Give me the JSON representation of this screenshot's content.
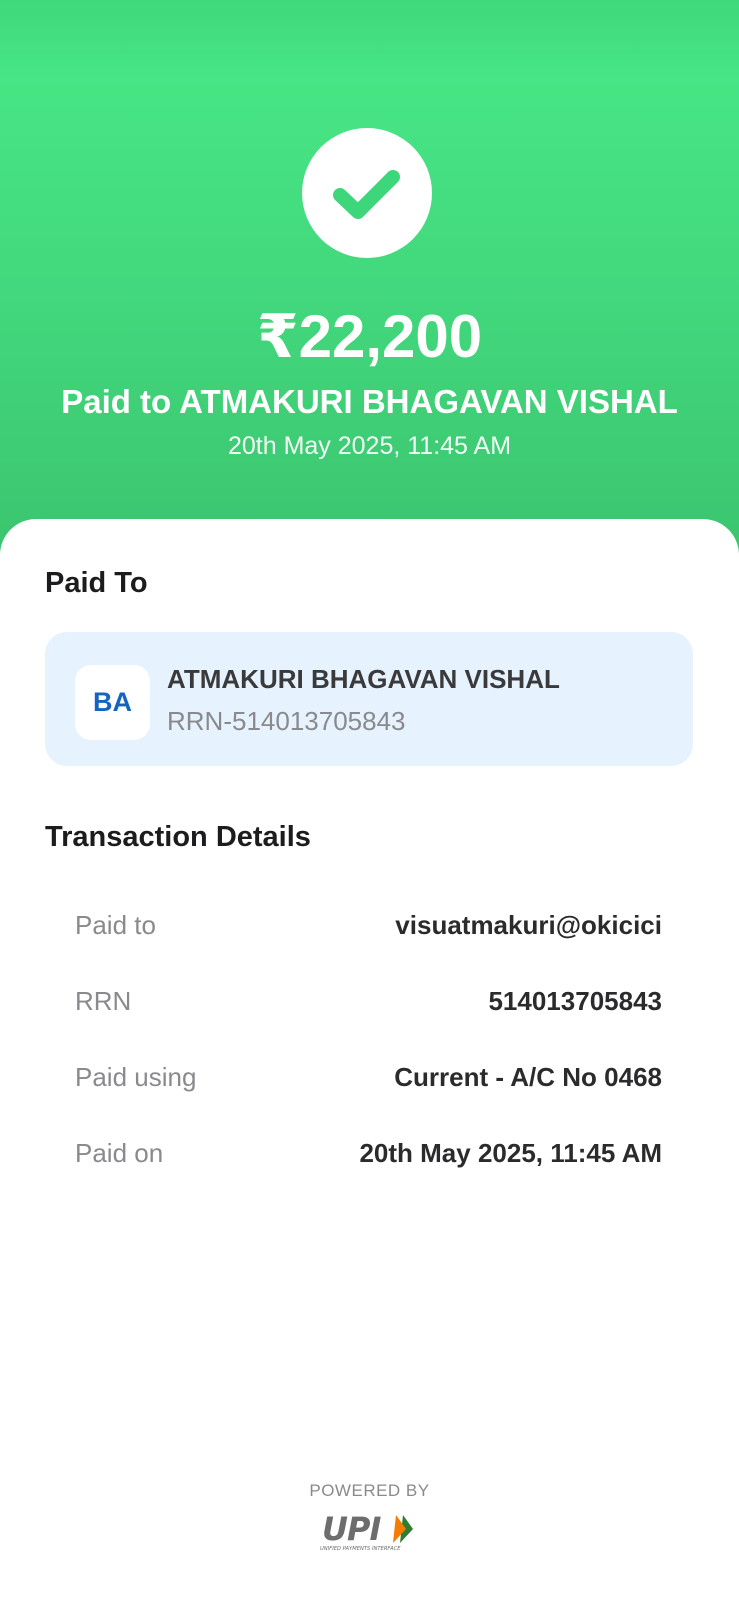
{
  "hero": {
    "amount": "₹22,200",
    "paid_to_line": "Paid to ATMAKURI BHAGAVAN VISHAL",
    "datetime": "20th May 2025, 11:45 AM",
    "status_icon": "check-icon",
    "accent_color": "#45e084"
  },
  "paid_to_section": {
    "title": "Paid To",
    "avatar_initials": "BA",
    "name": "ATMAKURI BHAGAVAN VISHAL",
    "rrn": "RRN-514013705843"
  },
  "transaction_details": {
    "title": "Transaction Details",
    "rows": [
      {
        "label": "Paid to",
        "value": "visuatmakuri@okicici"
      },
      {
        "label": "RRN",
        "value": "514013705843"
      },
      {
        "label": "Paid using",
        "value": "Current - A/C No 0468"
      },
      {
        "label": "Paid on",
        "value": "20th May 2025, 11:45 AM"
      }
    ]
  },
  "footer": {
    "powered_by": "POWERED BY",
    "logo_text": "UPI",
    "logo_subtext": "UNIFIED PAYMENTS INTERFACE"
  }
}
